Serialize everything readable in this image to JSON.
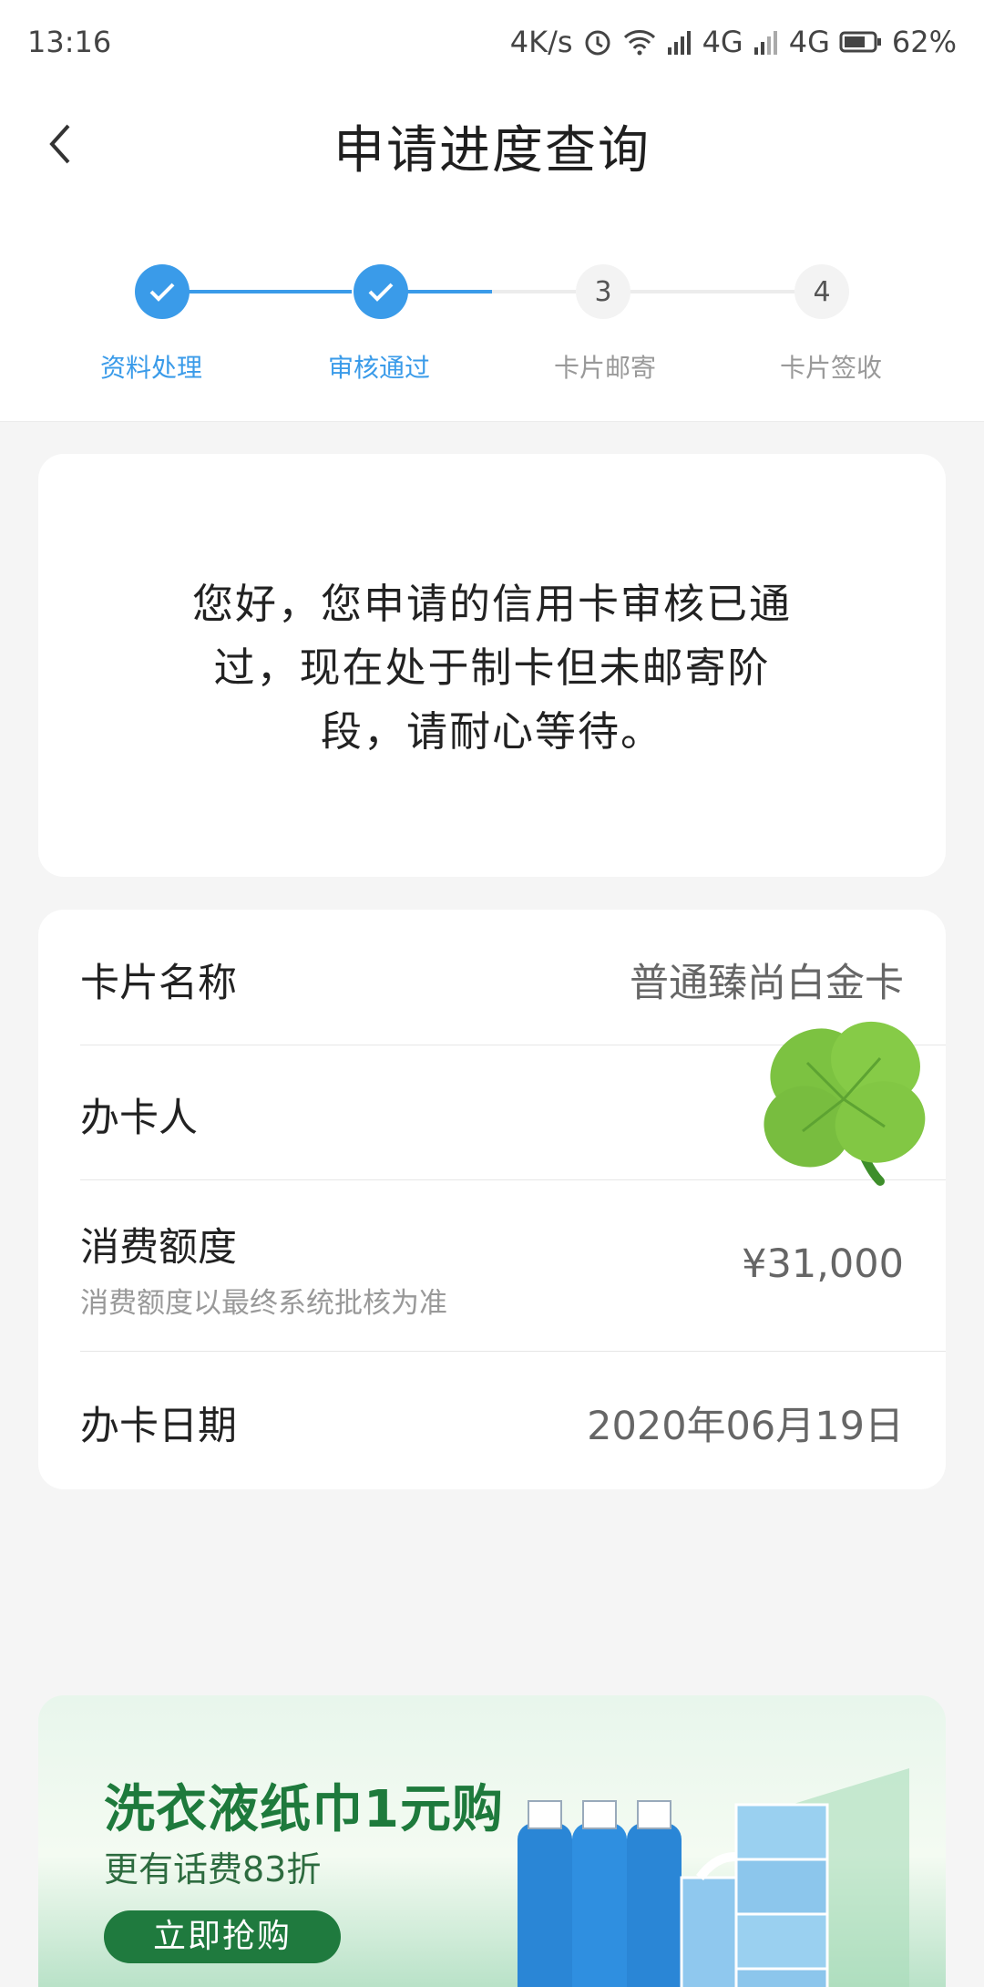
{
  "status_bar": {
    "time": "13:16",
    "speed": "4K/s",
    "net1": "4G",
    "net2": "4G",
    "battery": "62%"
  },
  "header": {
    "title": "申请进度查询"
  },
  "steps": [
    {
      "label": "资料处理",
      "state": "done",
      "number": ""
    },
    {
      "label": "审核通过",
      "state": "done",
      "number": ""
    },
    {
      "label": "卡片邮寄",
      "state": "todo",
      "number": "3"
    },
    {
      "label": "卡片签收",
      "state": "todo",
      "number": "4"
    }
  ],
  "message": {
    "text": "您好，您申请的信用卡审核已通过，现在处于制卡但未邮寄阶段，请耐心等待。"
  },
  "info": {
    "card_name_label": "卡片名称",
    "card_name_value": "普通臻尚白金卡",
    "holder_label": "办卡人",
    "limit_label": "消费额度",
    "limit_note": "消费额度以最终系统批核为准",
    "limit_value": "¥31,000",
    "date_label": "办卡日期",
    "date_value": "2020年06月19日"
  },
  "banner": {
    "title": "洗衣液纸巾1元购",
    "subtitle": "更有话费83折",
    "button": "立即抢购"
  },
  "colors": {
    "accent": "#3a9be9",
    "banner_green": "#1f7a3e"
  }
}
